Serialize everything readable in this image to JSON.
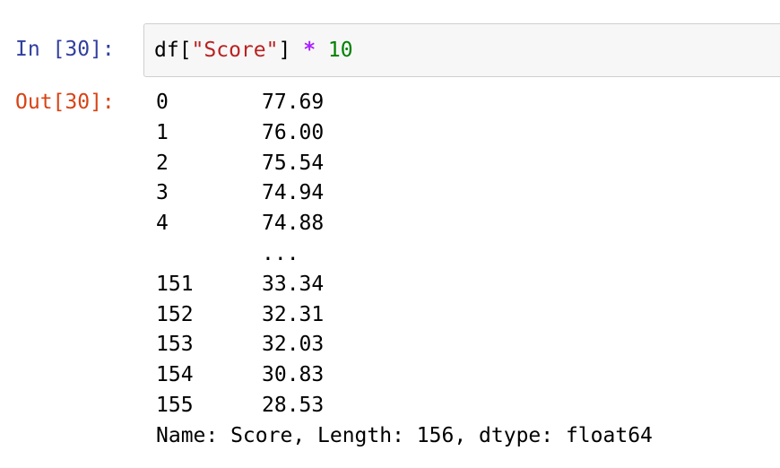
{
  "input": {
    "prompt": "In [30]:",
    "code": {
      "t1": "df[",
      "t2": "\"Score\"",
      "t3": "] ",
      "t4": "*",
      "t5": " ",
      "t6": "10"
    }
  },
  "output": {
    "prompt": "Out[30]:",
    "rows": [
      {
        "index": "0",
        "value": "77.69"
      },
      {
        "index": "1",
        "value": "76.00"
      },
      {
        "index": "2",
        "value": "75.54"
      },
      {
        "index": "3",
        "value": "74.94"
      },
      {
        "index": "4",
        "value": "74.88"
      },
      {
        "index": "",
        "value": "..."
      },
      {
        "index": "151",
        "value": "33.34"
      },
      {
        "index": "152",
        "value": "32.31"
      },
      {
        "index": "153",
        "value": "32.03"
      },
      {
        "index": "154",
        "value": "30.83"
      },
      {
        "index": "155",
        "value": "28.53"
      }
    ],
    "footer": "Name: Score, Length: 156, dtype: float64"
  },
  "colors": {
    "in_prompt": "#303f9f",
    "out_prompt": "#d84315",
    "string": "#ba2121",
    "operator": "#aa22ff",
    "number": "#008000",
    "input_background": "#f7f7f7"
  }
}
